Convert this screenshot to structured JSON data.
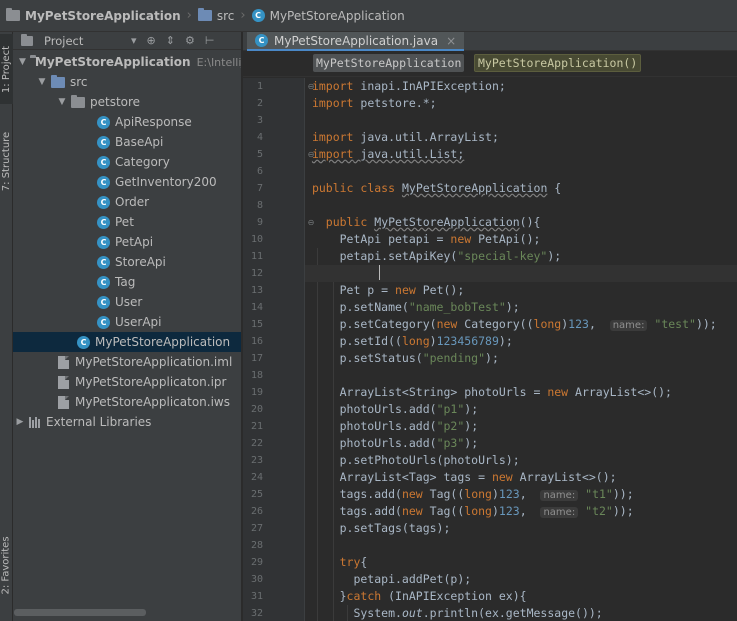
{
  "breadcrumb": {
    "project": "MyPetStoreApplication",
    "folder": "src",
    "file": "MyPetStoreApplication"
  },
  "toolstrip": {
    "project_tab": "1: Project",
    "structure_tab": "7: Structure",
    "favorites_tab": "2: Favorites"
  },
  "project_panel": {
    "view_label": "Project",
    "root_label": "MyPetStoreApplication",
    "root_path": "E:\\IntelliJP",
    "src_label": "src",
    "package_label": "petstore",
    "classes": [
      "ApiResponse",
      "BaseApi",
      "Category",
      "GetInventory200",
      "Order",
      "Pet",
      "PetApi",
      "StoreApi",
      "Tag",
      "User",
      "UserApi"
    ],
    "main_class": "MyPetStoreApplication",
    "files": [
      "MyPetStoreApplication.iml",
      "MyPetStoreApplicaton.ipr",
      "MyPetStoreApplicaton.iws"
    ],
    "external_libraries": "External Libraries"
  },
  "editor": {
    "tab_label": "MyPetStoreApplication.java",
    "class_chip": "MyPetStoreApplication",
    "method_chip": "MyPetStoreApplication()",
    "line_numbers": [
      "1",
      "2",
      "3",
      "4",
      "5",
      "6",
      "7",
      "8",
      "9",
      "10",
      "11",
      "12",
      "13",
      "14",
      "15",
      "16",
      "17",
      "18",
      "19",
      "20",
      "21",
      "22",
      "23",
      "24",
      "25",
      "26",
      "27",
      "28",
      "29",
      "30",
      "31",
      "32"
    ]
  },
  "colors": {
    "keyword": "#cc7832",
    "string": "#6a8759",
    "number": "#6897bb",
    "text": "#a9b7c6",
    "selection": "#0d293e",
    "class_icon": "#3592c4"
  }
}
